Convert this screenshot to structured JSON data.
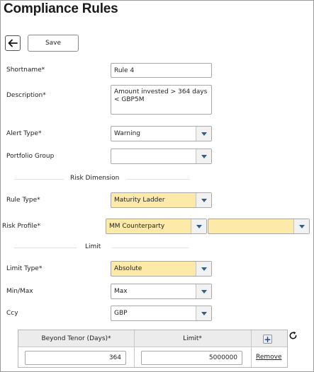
{
  "page": {
    "title": "Compliance Rules"
  },
  "toolbar": {
    "back_icon": "left-arrow-icon",
    "save_label": "Save"
  },
  "form": {
    "shortname": {
      "label": "Shortname*",
      "value": "Rule 4"
    },
    "description": {
      "label": "Description*",
      "value": "Amount invested  > 364 days < GBP5M"
    },
    "alert_type": {
      "label": "Alert Type*",
      "value": "Warning"
    },
    "portfolio_group": {
      "label": "Portfolio Group",
      "value": ""
    }
  },
  "risk_dimension": {
    "heading": "Risk Dimension",
    "rule_type": {
      "label": "Rule Type*",
      "value": "Maturity Ladder"
    },
    "risk_profile": {
      "label": "Risk Profile*",
      "value": "MM Counterparty",
      "value2": ""
    }
  },
  "limit": {
    "heading": "Limit",
    "limit_type": {
      "label": "Limit Type*",
      "value": "Absolute"
    },
    "min_max": {
      "label": "Min/Max",
      "value": "Max"
    },
    "ccy": {
      "label": "Ccy",
      "value": "GBP"
    }
  },
  "limits_table": {
    "headers": [
      "Beyond Tenor (Days)*",
      "Limit*"
    ],
    "add_icon": "plus-icon",
    "refresh_icon": "refresh-icon",
    "rows": [
      {
        "tenor": "364",
        "limit": "5000000",
        "action": "Remove"
      }
    ]
  },
  "colors": {
    "highlight": "#fde9a8",
    "caret": "#2f5f8a"
  }
}
